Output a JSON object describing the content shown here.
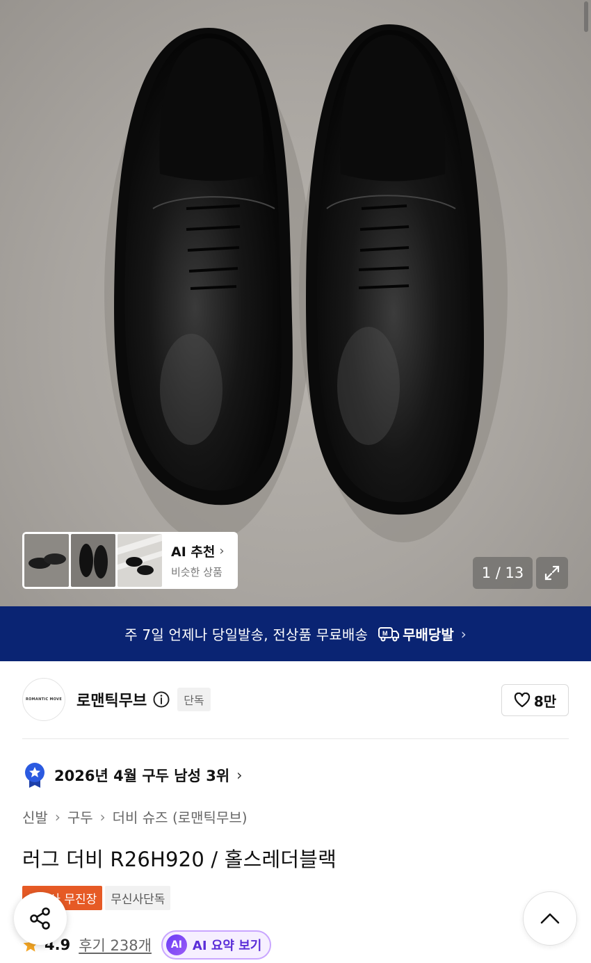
{
  "gallery": {
    "ai_card_title": "AI 추천",
    "ai_card_subtitle": "비슷한 상품",
    "counter": "1 / 13"
  },
  "banner": {
    "text": "주 7일 언제나 당일발송, 전상품 무료배송",
    "logo_text": "무배당발"
  },
  "brand": {
    "logo_text": "ROMANTIC MOVE",
    "name": "로맨틱무브",
    "badge": "단독",
    "likes": "8만"
  },
  "rank": {
    "text": "2026년 4월 구두 남성 3위"
  },
  "breadcrumb": {
    "items": [
      "신발",
      "구두",
      "더비 슈즈 (로맨틱무브)"
    ]
  },
  "product": {
    "title": "러그 더비 R26H920 / 홀스레더블랙",
    "tags": [
      "무신사 무진장",
      "무신사단독"
    ],
    "rating": "4.9",
    "reviews": "후기 238개",
    "ai_summary": "AI 요약 보기",
    "ai_badge": "AI"
  },
  "colors": {
    "banner_bg": "#0a2473",
    "tag_orange": "#e65a25",
    "ai_purple": "#5b2ed8",
    "star": "#f5a623"
  },
  "icons": [
    "expand-icon",
    "info-icon",
    "heart-icon",
    "rank-medal-icon",
    "share-icon",
    "arrow-up-icon",
    "star-icon",
    "delivery-truck-icon"
  ]
}
